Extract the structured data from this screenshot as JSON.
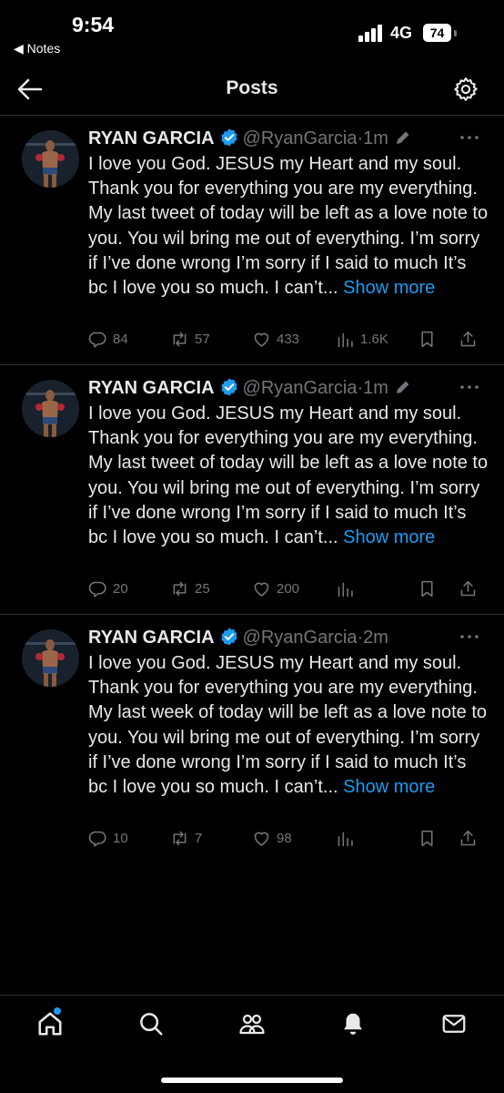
{
  "status_bar": {
    "time": "9:54",
    "back_app": "◀ Notes",
    "network": "4G",
    "battery": "74"
  },
  "header": {
    "title": "Posts"
  },
  "colors": {
    "accent": "#1d9bf0",
    "muted": "#71767b",
    "text": "#e7e9ea",
    "background": "#000000"
  },
  "posts": [
    {
      "name": "RYAN GARCIA",
      "handle": "@RyanGarcia",
      "sep": "·",
      "age": "1m",
      "edited": true,
      "text": "I love you God. JESUS my Heart and my soul. Thank you for everything you are my everything. My last tweet of today will be left as a love note to you. You wil bring me out of everything. I’m sorry if I’ve done wrong I’m sorry if I said to much It’s bc I love you so much. I can’t...",
      "show_more": "Show more",
      "replies": "84",
      "reposts": "57",
      "likes": "433",
      "views": "1.6K"
    },
    {
      "name": "RYAN GARCIA",
      "handle": "@RyanGarcia",
      "sep": "·",
      "age": "1m",
      "edited": true,
      "text": "I love you God. JESUS my Heart and my soul. Thank you for everything you are my everything. My last tweet of today will be left as a love note to you. You wil bring me out of everything. I’m sorry if I’ve done wrong I’m sorry if I said to much It’s bc I love you so much. I can’t...",
      "show_more": "Show more",
      "replies": "20",
      "reposts": "25",
      "likes": "200",
      "views": ""
    },
    {
      "name": "RYAN GARCIA",
      "handle": "@RyanGarcia",
      "sep": "·",
      "age": "2m",
      "edited": false,
      "text": "I love you God. JESUS my Heart and my soul. Thank you for everything you are my everything. My last week of today will be left as a love note to you. You wil bring me out of everything. I’m sorry if I’ve done wrong I’m sorry if I said to much It’s bc I love you so much. I can’t...",
      "show_more": "Show more",
      "replies": "10",
      "reposts": "7",
      "likes": "98",
      "views": ""
    }
  ],
  "icons": {
    "post_actions": [
      "reply-icon",
      "repost-icon",
      "like-icon",
      "views-icon",
      "bookmark-icon",
      "share-icon"
    ],
    "nav": [
      "home-icon",
      "search-icon",
      "communities-icon",
      "notifications-icon",
      "messages-icon"
    ]
  }
}
